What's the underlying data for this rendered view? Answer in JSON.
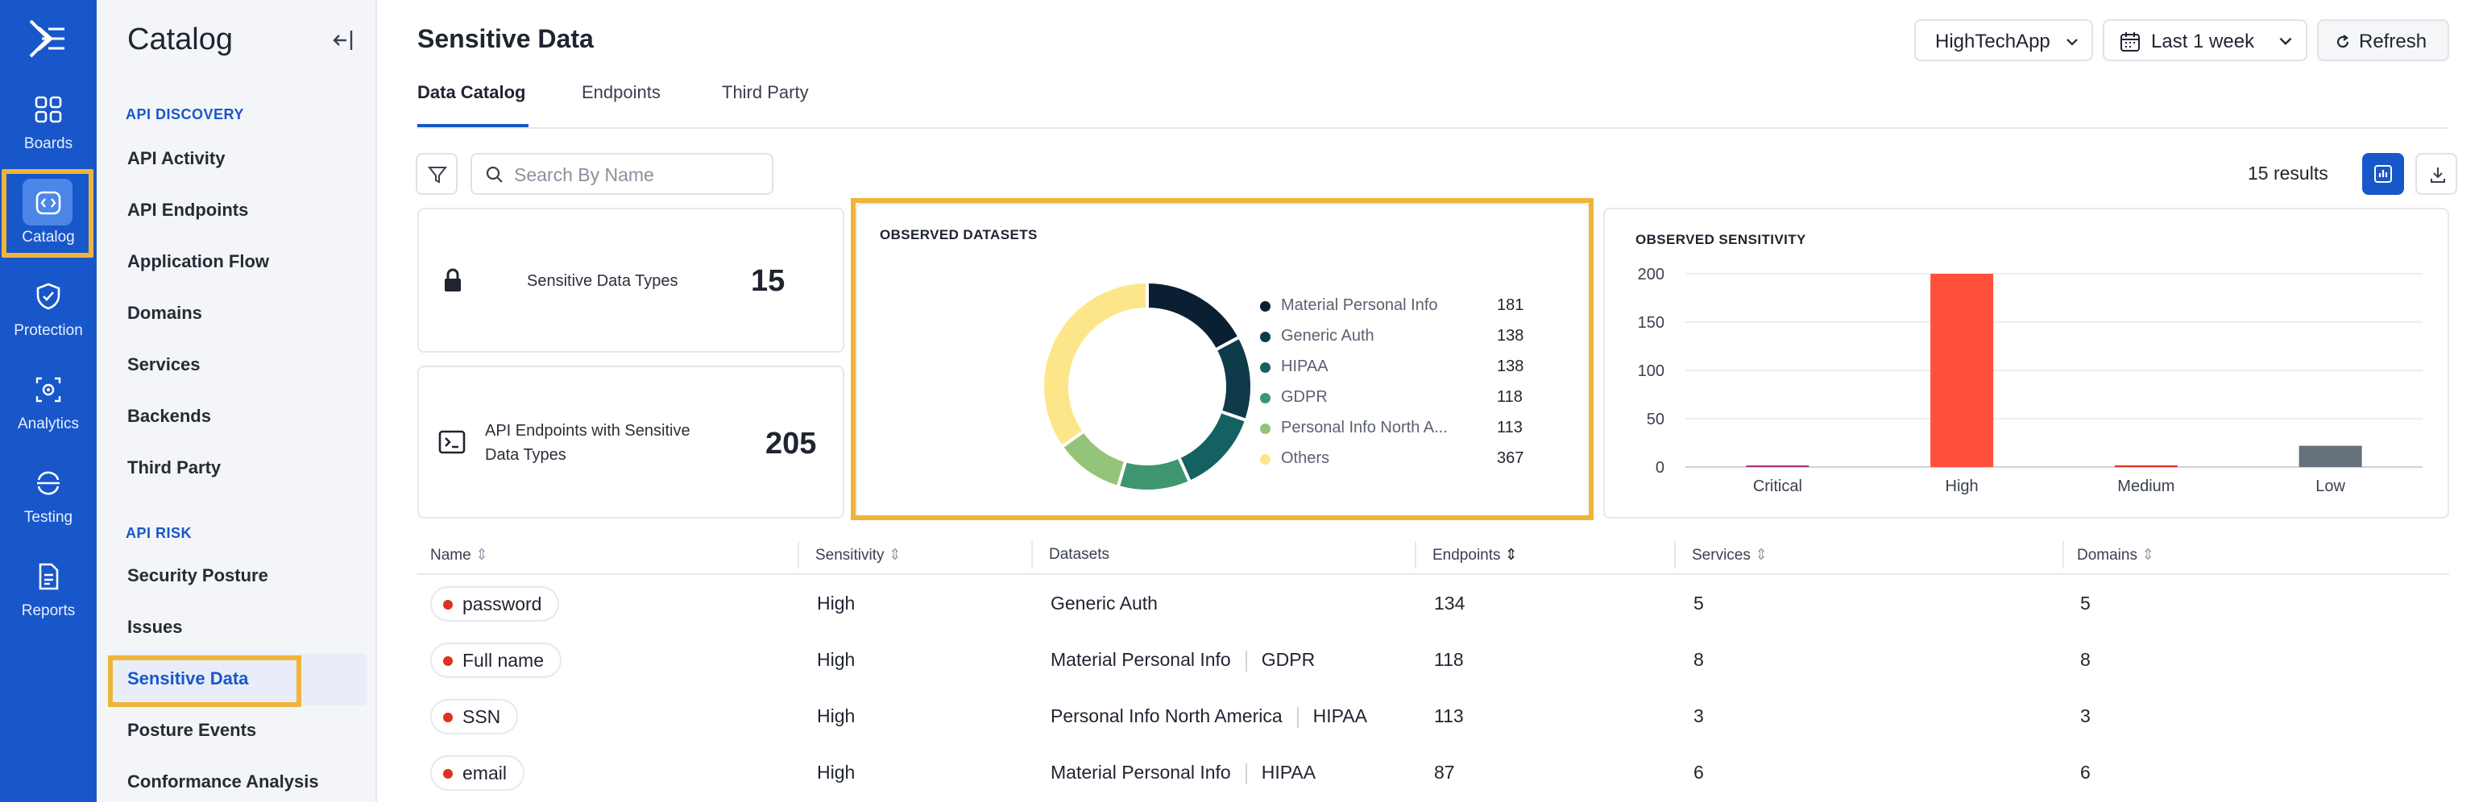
{
  "rail": {
    "items": [
      {
        "label": "Boards",
        "icon": "grid-icon"
      },
      {
        "label": "Catalog",
        "icon": "catalog-icon"
      },
      {
        "label": "Protection",
        "icon": "shield-icon"
      },
      {
        "label": "Analytics",
        "icon": "analytics-icon"
      },
      {
        "label": "Testing",
        "icon": "testing-icon"
      },
      {
        "label": "Reports",
        "icon": "reports-icon"
      }
    ],
    "active": "Catalog"
  },
  "nav": {
    "title": "Catalog",
    "sections": [
      {
        "heading": "API DISCOVERY",
        "items": [
          "API Activity",
          "API Endpoints",
          "Application Flow",
          "Domains",
          "Services",
          "Backends",
          "Third Party"
        ]
      },
      {
        "heading": "API RISK",
        "items": [
          "Security Posture",
          "Issues",
          "Sensitive Data",
          "Posture Events",
          "Conformance Analysis"
        ]
      }
    ],
    "active_item": "Sensitive Data"
  },
  "header": {
    "title": "Sensitive Data",
    "app_select": "HighTechApp",
    "time_range": "Last 1 week",
    "refresh": "Refresh"
  },
  "tabs": [
    "Data Catalog",
    "Endpoints",
    "Third Party"
  ],
  "active_tab": "Data Catalog",
  "toolbar": {
    "search_placeholder": "Search By Name",
    "results": "15 results"
  },
  "stats": {
    "types_label": "Sensitive Data Types",
    "types_value": "15",
    "endpoints_label_1": "API Endpoints with Sensitive",
    "endpoints_label_2": "Data Types",
    "endpoints_value": "205"
  },
  "colors": {
    "brand": "#1857c9",
    "highlight": "#efb43a",
    "status_high": "#e0301e"
  },
  "chart_data": [
    {
      "type": "pie",
      "title": "OBSERVED DATASETS",
      "donut": true,
      "legend_position": "right",
      "slices": [
        {
          "name": "Material Personal Info",
          "value": 181,
          "color": "#0b1f33"
        },
        {
          "name": "Generic Auth",
          "value": 138,
          "color": "#0e3a4a"
        },
        {
          "name": "HIPAA",
          "value": 138,
          "color": "#146162"
        },
        {
          "name": "GDPR",
          "value": 118,
          "color": "#3e9670"
        },
        {
          "name": "Personal Info North America",
          "display_name": "Personal Info North A...",
          "value": 113,
          "color": "#94c47a"
        },
        {
          "name": "Others",
          "value": 367,
          "color": "#fde68a"
        }
      ]
    },
    {
      "type": "bar",
      "title": "OBSERVED SENSITIVITY",
      "categories": [
        "Critical",
        "High",
        "Medium",
        "Low"
      ],
      "values": [
        1,
        200,
        1,
        22
      ],
      "colors": [
        "#b0307a",
        "#ff503c",
        "#e0301e",
        "#66707a"
      ],
      "yticks": [
        "0",
        "50",
        "100",
        "150",
        "200"
      ],
      "ylim": [
        0,
        200
      ],
      "grid": true
    }
  ],
  "table": {
    "columns": [
      "Name",
      "Sensitivity",
      "Datasets",
      "Endpoints",
      "Services",
      "Domains"
    ],
    "rows": [
      {
        "name": "password",
        "sensitivity": "High",
        "datasets": [
          "Generic Auth"
        ],
        "endpoints": "134",
        "services": "5",
        "domains": "5"
      },
      {
        "name": "Full name",
        "sensitivity": "High",
        "datasets": [
          "Material Personal Info",
          "GDPR"
        ],
        "endpoints": "118",
        "services": "8",
        "domains": "8"
      },
      {
        "name": "SSN",
        "sensitivity": "High",
        "datasets": [
          "Personal Info North America",
          "HIPAA"
        ],
        "endpoints": "113",
        "services": "3",
        "domains": "3"
      },
      {
        "name": "email",
        "sensitivity": "High",
        "datasets": [
          "Material Personal Info",
          "HIPAA"
        ],
        "endpoints": "87",
        "services": "6",
        "domains": "6"
      }
    ]
  }
}
